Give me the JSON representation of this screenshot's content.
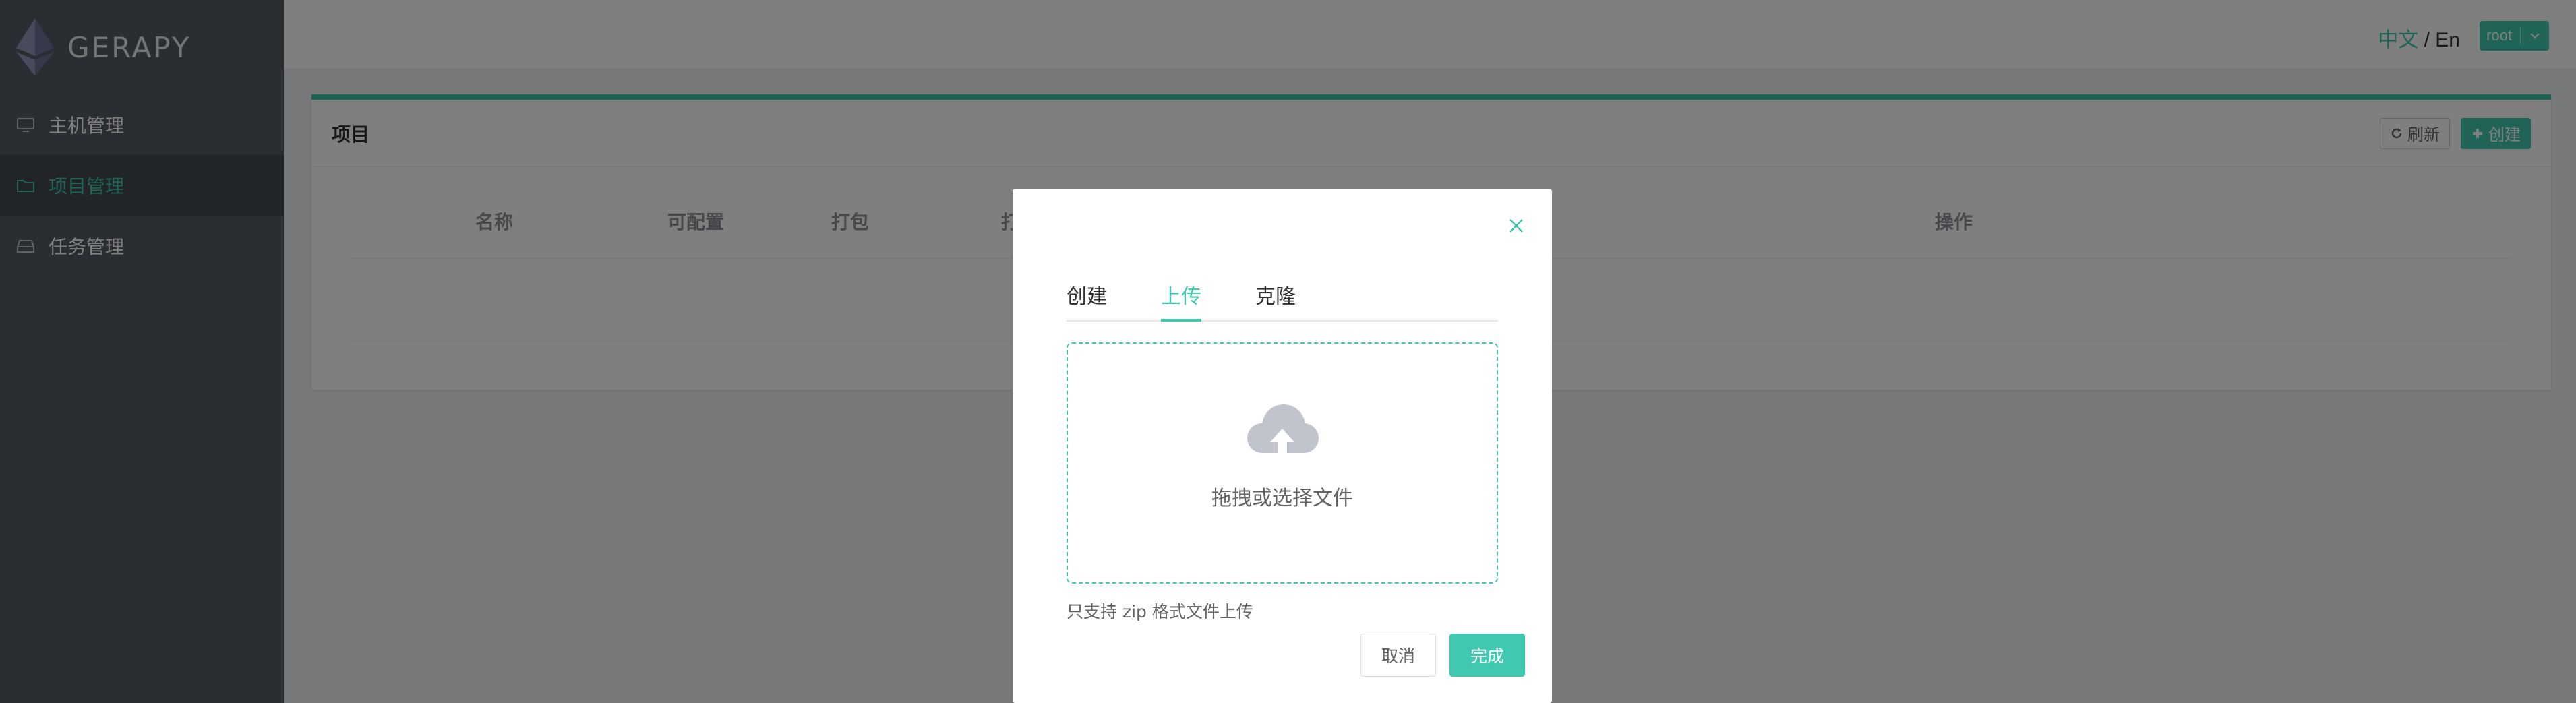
{
  "brand": {
    "name": "GERAPY"
  },
  "sidebar": {
    "items": [
      {
        "label": "主机管理",
        "icon": "monitor-icon",
        "active": false
      },
      {
        "label": "项目管理",
        "icon": "folder-icon",
        "active": true
      },
      {
        "label": "任务管理",
        "icon": "inbox-icon",
        "active": false
      }
    ]
  },
  "header": {
    "lang_zh": "中文",
    "lang_sep": " / ",
    "lang_en": "En",
    "user": "root"
  },
  "panel": {
    "title": "项目",
    "refresh_label": "刷新",
    "create_label": "创建"
  },
  "table": {
    "columns": [
      "名称",
      "可配置",
      "打包",
      "打包时",
      "操作"
    ]
  },
  "dialog": {
    "tabs": [
      {
        "label": "创建",
        "active": false
      },
      {
        "label": "上传",
        "active": true
      },
      {
        "label": "克隆",
        "active": false
      }
    ],
    "dropzone_text": "拖拽或选择文件",
    "tip": "只支持 zip 格式文件上传",
    "cancel_label": "取消",
    "done_label": "完成"
  },
  "colors": {
    "accent": "#41c8b0",
    "sidebar_bg": "#545c64",
    "sidebar_active_bg": "#434a50"
  }
}
